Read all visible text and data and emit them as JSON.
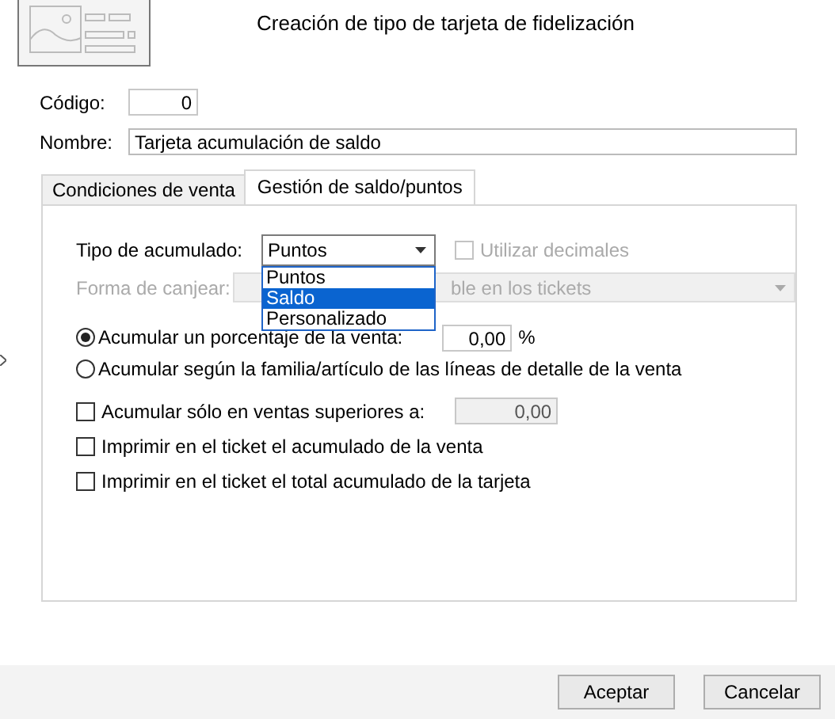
{
  "title": "Creación de tipo de tarjeta de fidelización",
  "codigo": {
    "label": "Código:",
    "value": "0"
  },
  "nombre": {
    "label": "Nombre:",
    "value": "Tarjeta acumulación de saldo"
  },
  "tabs": [
    {
      "label": "Condiciones de venta",
      "selected": false
    },
    {
      "label": "Gestión de saldo/puntos",
      "selected": true
    }
  ],
  "tipo": {
    "label": "Tipo de acumulado:",
    "value": "Puntos",
    "options": [
      {
        "label": "Puntos",
        "highlighted": false
      },
      {
        "label": "Saldo",
        "highlighted": true
      },
      {
        "label": "Personalizado",
        "highlighted": false
      }
    ]
  },
  "decimales": {
    "label": "Utilizar decimales",
    "checked": false,
    "disabled": true
  },
  "canjear": {
    "label": "Forma de canjear:",
    "value": "ble en los tickets",
    "disabled": true
  },
  "radios": [
    {
      "label": "Acumular un porcentaje de la venta:",
      "selected": true,
      "value": "0,00",
      "unit": "%"
    },
    {
      "label": "Acumular según la familia/artículo de las líneas de detalle de la venta",
      "selected": false
    }
  ],
  "checks": [
    {
      "label": "Acumular sólo en ventas superiores a:",
      "checked": false,
      "value": "0,00"
    },
    {
      "label": "Imprimir en el ticket el acumulado de la venta",
      "checked": false
    },
    {
      "label": "Imprimir en el ticket el total acumulado de la tarjeta",
      "checked": false
    }
  ],
  "buttons": [
    "Aceptar",
    "Cancelar"
  ]
}
